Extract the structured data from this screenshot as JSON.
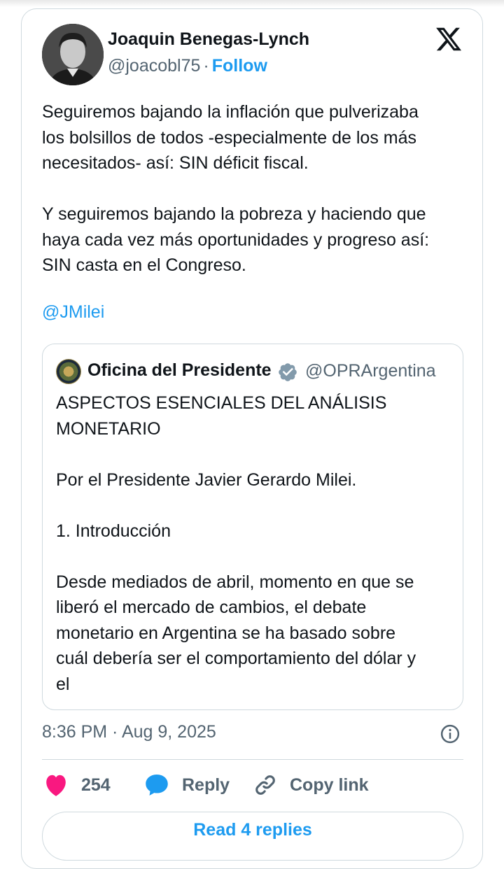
{
  "tweet": {
    "author_name": "Joaquin Benegas-Lynch",
    "handle": "@joacobl75",
    "separator": "·",
    "follow_label": "Follow",
    "text": "Seguiremos bajando la inflación que pulverizaba\nlos bolsillos de todos -especialmente de los más\nnecesitados- así: SIN déficit fiscal.\n\nY seguiremos bajando la pobreza y haciendo que\nhaya cada vez más oportunidades y progreso así:\nSIN casta en el Congreso.",
    "mention": "@JMilei",
    "timestamp": "8:36 PM · Aug 9, 2025",
    "like_count": "254",
    "reply_label": "Reply",
    "copy_link_label": "Copy link",
    "read_replies_label": "Read 4 replies"
  },
  "quoted_tweet": {
    "author_name": "Oficina del Presidente",
    "handle": "@OPRArgentina",
    "text": "ASPECTOS ESENCIALES DEL ANÁLISIS\nMONETARIO\n\nPor el Presidente Javier Gerardo Milei.\n\n1. Introducción\n\nDesde mediados de abril, momento en que se\nliberó el mercado de cambios, el debate\nmonetario en Argentina se ha basado sobre\ncuál debería ser el comportamiento del dólar y\nel"
  },
  "icons": {
    "logo": "x-logo-icon",
    "verified": "verified-badge-icon",
    "info": "info-icon",
    "like": "heart-icon",
    "reply": "speech-bubble-icon",
    "copy": "link-icon"
  },
  "colors": {
    "accent": "#1d9bf0",
    "like": "#f91880",
    "muted": "#536471",
    "text": "#0f1419",
    "border": "#cfd9de",
    "verified": "#829aab"
  }
}
